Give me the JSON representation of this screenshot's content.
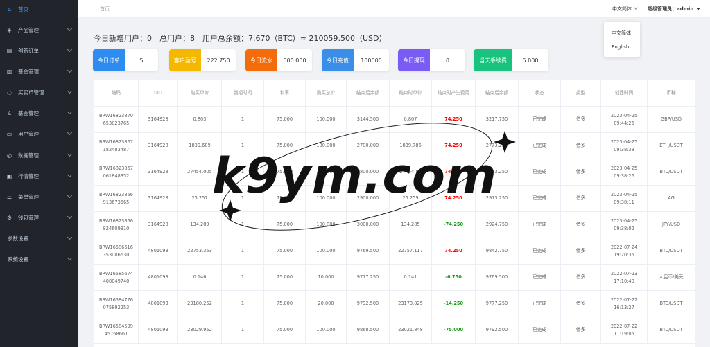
{
  "sidebar": {
    "items": [
      {
        "label": "首页",
        "icon": "home-icon",
        "glyph": "⌂",
        "active": true,
        "chevron": false
      },
      {
        "label": "产品管理",
        "icon": "cube-icon",
        "glyph": "◈",
        "chevron": true
      },
      {
        "label": "创新订单",
        "icon": "clipboard-icon",
        "glyph": "▤",
        "chevron": true
      },
      {
        "label": "基金管理",
        "icon": "bank-icon",
        "glyph": "▥",
        "chevron": true
      },
      {
        "label": "买卖币管理",
        "icon": "exchange-icon",
        "glyph": "◌",
        "chevron": true
      },
      {
        "label": "基金管理",
        "icon": "user-icon",
        "glyph": "♙",
        "chevron": true
      },
      {
        "label": "用户管理",
        "icon": "document-icon",
        "glyph": "▭",
        "chevron": true
      },
      {
        "label": "数据管理",
        "icon": "database-icon",
        "glyph": "◎",
        "chevron": true
      },
      {
        "label": "行情管理",
        "icon": "wallet-icon",
        "glyph": "▣",
        "chevron": true
      },
      {
        "label": "菜单管理",
        "icon": "list-icon",
        "glyph": "☰",
        "chevron": true
      },
      {
        "label": "钱包管理",
        "icon": "gear-icon",
        "glyph": "⚙",
        "chevron": true
      },
      {
        "label": "参数设置",
        "icon": "",
        "glyph": "",
        "chevron": true,
        "plain": true
      },
      {
        "label": "系统设置",
        "icon": "",
        "glyph": "",
        "chevron": true,
        "plain": true
      }
    ]
  },
  "header": {
    "breadcrumb": "首页",
    "language": "中文简体",
    "admin_label": "超级管理员：",
    "admin_name": "admin"
  },
  "lang_dropdown": [
    "中文简体",
    "English"
  ],
  "stats_line": "今日新增用户：0　总用户：8　用户总余额：7.670（BTC）≈ 210059.500（USD）",
  "cards": [
    {
      "label": "今日订单",
      "value": "5",
      "color": "#2d8cf0"
    },
    {
      "label": "客户盈亏",
      "value": "222.750",
      "color": "#f5b800"
    },
    {
      "label": "今日流水",
      "value": "500.000",
      "color": "#f46c0a"
    },
    {
      "label": "今日充值",
      "value": "100000",
      "color": "#3a8ee6"
    },
    {
      "label": "今日提现",
      "value": "0",
      "color": "#7a5cf4"
    },
    {
      "label": "当天手续费",
      "value": "5.000",
      "color": "#19c37d"
    }
  ],
  "table": {
    "headers": [
      "编码",
      "UID",
      "购买单价",
      "到期时间",
      "利率",
      "购买总价",
      "结束后余额",
      "结束时单价",
      "结束时产生费用",
      "结束后余额",
      "状态",
      "类型",
      "创建时间",
      "币种"
    ],
    "rows": [
      [
        "BRW16823870 653023765",
        "3164928",
        "0.803",
        "1",
        "75.000",
        "100.000",
        "3144.500",
        "0.807",
        "74.250",
        "3217.750",
        "已完成",
        "借多",
        "2023-04-25 09:44:25",
        "GBP/USD"
      ],
      [
        "BRW16823867 182483487",
        "3164928",
        "1839.689",
        "1",
        "75.000",
        "100.000",
        "2700.000",
        "1839.786",
        "74.250",
        "2773.250",
        "已完成",
        "借多",
        "2023-04-25 09:38:38",
        "ETH/USDT"
      ],
      [
        "BRW16823867 061848352",
        "3164928",
        "27454.005",
        "1",
        "75.000",
        "100.000",
        "2800.000",
        "27454.83",
        "74.250",
        "2873.250",
        "已完成",
        "借多",
        "2023-04-25 09:38:26",
        "BTC/USDT"
      ],
      [
        "BRW16823866 913673565",
        "3164928",
        "25.257",
        "1",
        "75.000",
        "100.000",
        "2900.000",
        "25.259",
        "74.250",
        "2973.250",
        "已完成",
        "借多",
        "2023-04-25 09:38:11",
        "AG"
      ],
      [
        "BRW16823866 824609310",
        "3164928",
        "134.289",
        "1",
        "75.000",
        "100.000",
        "3000.000",
        "134.285",
        "-74.250",
        "2924.750",
        "已完成",
        "借多",
        "2023-04-25 09:38:02",
        "JPY/USD"
      ],
      [
        "BRW16586616 353006630",
        "4801093",
        "22753.353",
        "1",
        "75.000",
        "100.000",
        "9769.500",
        "22757.117",
        "74.250",
        "9842.750",
        "已完成",
        "借多",
        "2022-07-24 19:20:35",
        "BTC/USDT"
      ],
      [
        "BRW16585674 408049740",
        "4801093",
        "0.146",
        "1",
        "75.000",
        "10.000",
        "9777.250",
        "0.141",
        "-6.750",
        "9769.500",
        "已完成",
        "借多",
        "2022-07-23 17:10:40",
        "人民币/美元"
      ],
      [
        "BRW16584776 075892253",
        "4801093",
        "23180.252",
        "1",
        "75.000",
        "20.000",
        "9792.500",
        "23173.025",
        "-14.250",
        "9777.250",
        "已完成",
        "借多",
        "2022-07-22 16:13:27",
        "BTC/USDT"
      ],
      [
        "BRW16584599 45768661",
        "4801093",
        "23029.952",
        "1",
        "75.000",
        "100.000",
        "9868.500",
        "23021.848",
        "-75.000",
        "9792.500",
        "已完成",
        "借多",
        "2022-07-22 11:19:05",
        "BTC/USDT"
      ]
    ]
  },
  "watermark": "k9ym.com"
}
